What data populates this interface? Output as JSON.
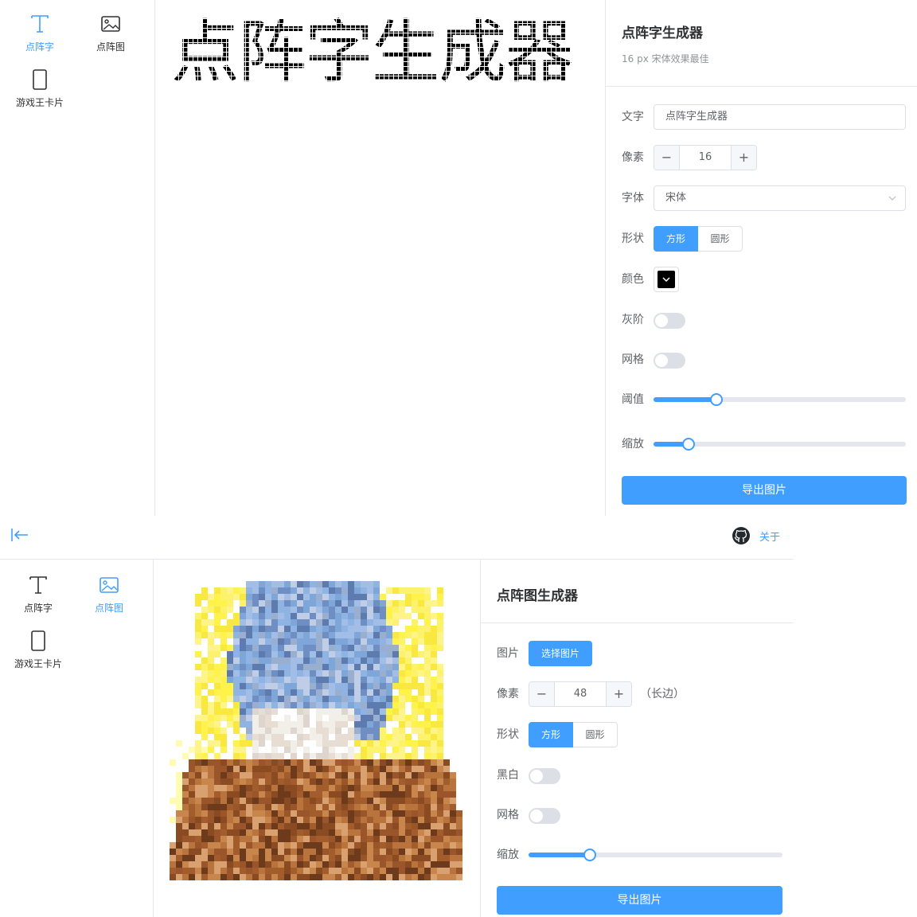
{
  "sidebar": {
    "tools": [
      {
        "label": "点阵字",
        "icon": "text-t-icon"
      },
      {
        "label": "点阵图",
        "icon": "image-icon"
      },
      {
        "label": "游戏王卡片",
        "icon": "card-icon"
      }
    ]
  },
  "text_generator": {
    "preview_text": "点阵字生成器",
    "title": "点阵字生成器",
    "subtitle": "16 px 宋体效果最佳",
    "fields": {
      "text": {
        "label": "文字",
        "value": "点阵字生成器"
      },
      "pixel": {
        "label": "像素",
        "value": "16",
        "minus": "−",
        "plus": "+"
      },
      "font": {
        "label": "字体",
        "value": "宋体"
      },
      "shape": {
        "label": "形状",
        "options": [
          "方形",
          "圆形"
        ],
        "selected": "方形"
      },
      "color": {
        "label": "颜色",
        "value": "#000000"
      },
      "grayscale": {
        "label": "灰阶",
        "on": false
      },
      "grid": {
        "label": "网格",
        "on": false
      },
      "threshold": {
        "label": "阈值",
        "fraction": 0.25
      },
      "zoom": {
        "label": "缩放",
        "fraction": 0.14
      }
    },
    "export_label": "导出图片"
  },
  "image_generator": {
    "header": {
      "collapse_icon": "collapse-left-icon",
      "github_icon": "github-icon",
      "about_label": "关于"
    },
    "title": "点阵图生成器",
    "fields": {
      "image": {
        "label": "图片",
        "button": "选择图片"
      },
      "pixel": {
        "label": "像素",
        "value": "48",
        "suffix": "（长边）",
        "minus": "−",
        "plus": "+"
      },
      "shape": {
        "label": "形状",
        "options": [
          "方形",
          "圆形"
        ],
        "selected": "方形"
      },
      "bw": {
        "label": "黑白",
        "on": false
      },
      "grid": {
        "label": "网格",
        "on": false
      },
      "zoom": {
        "label": "缩放",
        "fraction": 0.24
      }
    },
    "export_label": "导出图片"
  },
  "colors": {
    "accent": "#409eff",
    "border": "#dcdfe6",
    "text": "#606266"
  }
}
